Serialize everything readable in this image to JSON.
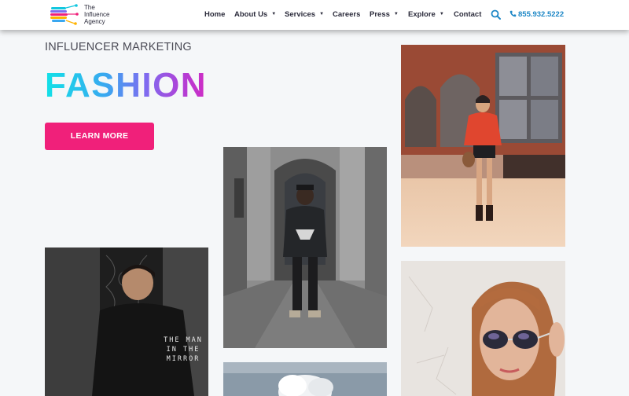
{
  "brand": {
    "name_line1": "The",
    "name_line2": "Influence",
    "name_line3": "Agency"
  },
  "nav": {
    "items": [
      {
        "label": "Home",
        "has_dropdown": false
      },
      {
        "label": "About Us",
        "has_dropdown": true
      },
      {
        "label": "Services",
        "has_dropdown": true
      },
      {
        "label": "Careers",
        "has_dropdown": false
      },
      {
        "label": "Press",
        "has_dropdown": true
      },
      {
        "label": "Explore",
        "has_dropdown": true
      },
      {
        "label": "Contact",
        "has_dropdown": false
      }
    ],
    "caret_glyph": "▼",
    "search_icon": "search-icon",
    "phone_icon": "phone-icon",
    "phone": "855.932.5222"
  },
  "hero": {
    "kicker": "INFLUENCER MARKETING",
    "headline": "FASHION",
    "cta_label": "LEARN MORE"
  },
  "photos": {
    "shirt_print": [
      "THE MAN",
      "IN THE",
      "MIRROR"
    ]
  },
  "colors": {
    "accent_pink": "#f0207a",
    "phone_blue": "#1d87c6",
    "gradient": [
      "#12e1e7",
      "#3aa7f0",
      "#7e6cf0",
      "#b23fd6",
      "#cf2bc4"
    ],
    "background": "#f5f7f9"
  }
}
